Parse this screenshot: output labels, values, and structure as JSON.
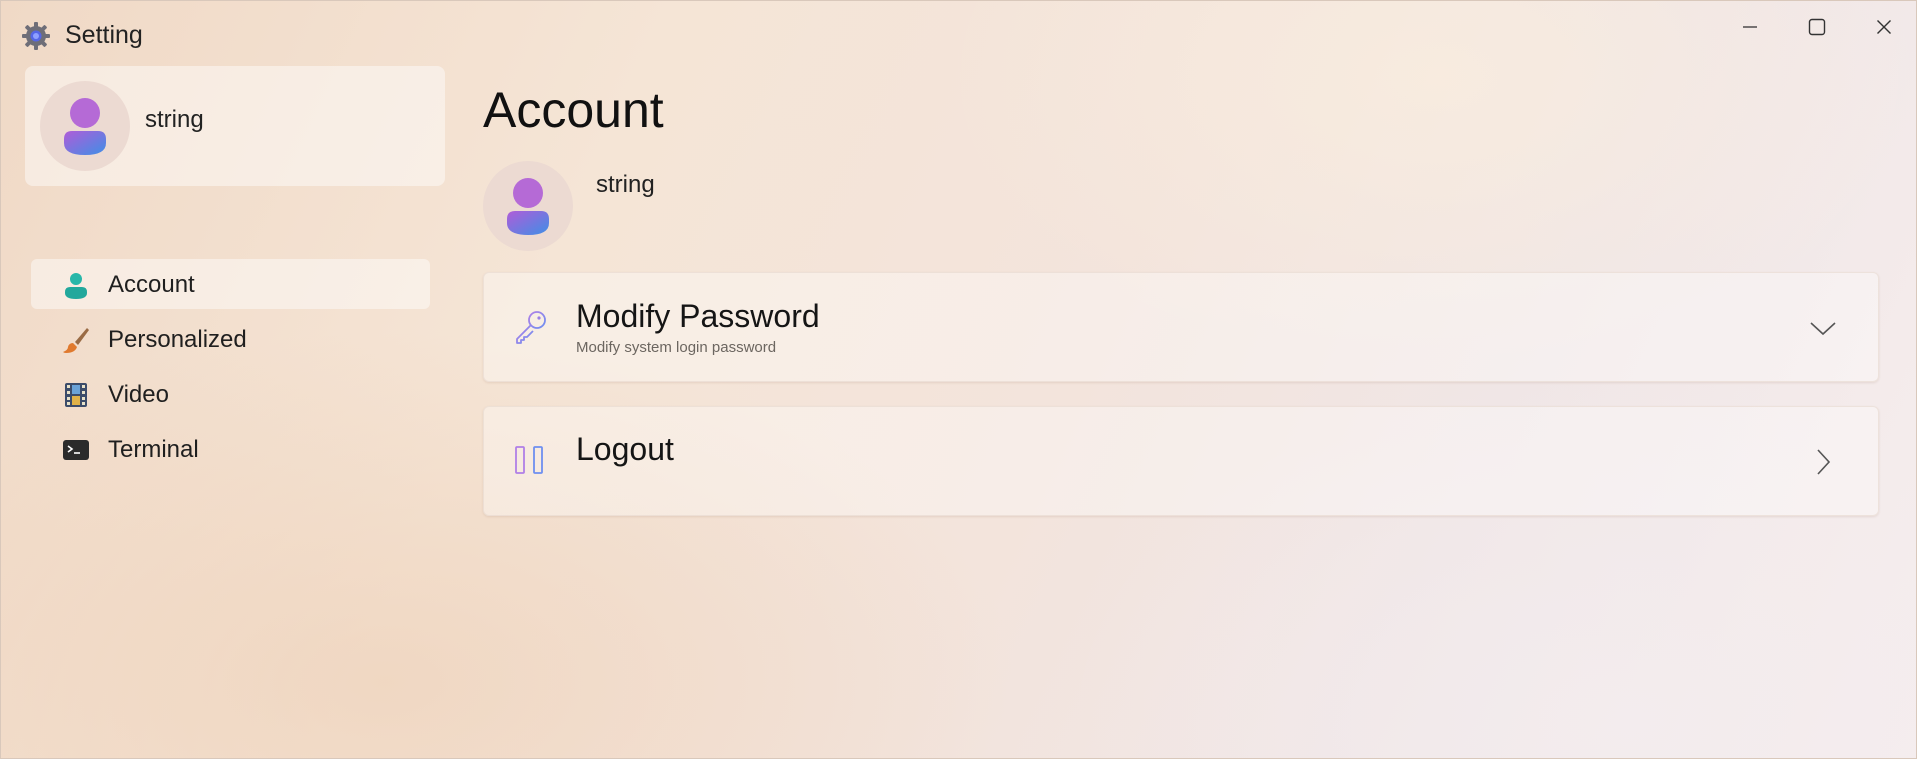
{
  "window": {
    "title": "Setting",
    "icon": "gear-icon"
  },
  "sidebar": {
    "profile": {
      "name": "string",
      "avatar_icon": "person-icon"
    },
    "items": [
      {
        "label": "Account",
        "icon": "person-icon",
        "active": true
      },
      {
        "label": "Personalized",
        "icon": "paintbrush-icon",
        "active": false
      },
      {
        "label": "Video",
        "icon": "film-icon",
        "active": false
      },
      {
        "label": "Terminal",
        "icon": "terminal-icon",
        "active": false
      }
    ]
  },
  "main": {
    "title": "Account",
    "user": {
      "name": "string"
    },
    "cards": [
      {
        "title": "Modify Password",
        "subtitle": "Modify system login password",
        "icon": "key-icon",
        "action_icon": "chevron-down-icon"
      },
      {
        "title": "Logout",
        "subtitle": "",
        "icon": "logout-icon",
        "action_icon": "chevron-right-icon"
      }
    ]
  },
  "colors": {
    "avatar_head": "#b069d6",
    "avatar_body_start": "#9b5fe0",
    "avatar_body_end": "#4f8de8",
    "account_icon": "#27b3a7",
    "accent_purple": "#a77be8",
    "accent_blue": "#6f8ff0"
  }
}
